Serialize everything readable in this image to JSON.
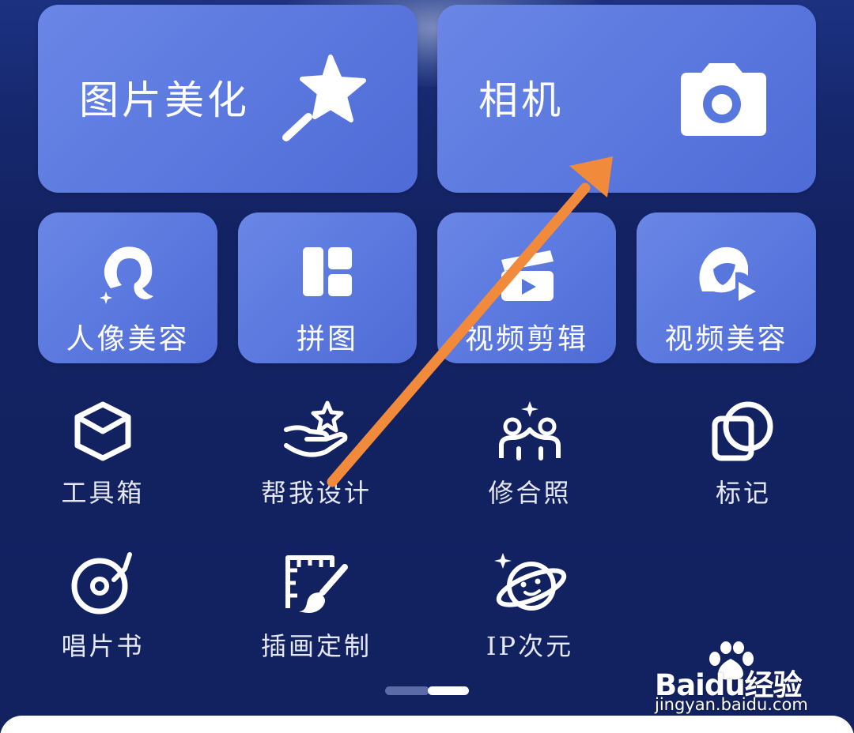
{
  "big_cards": [
    {
      "label": "图片美化",
      "icon": "magic-wand-icon"
    },
    {
      "label": "相机",
      "icon": "camera-icon"
    }
  ],
  "small_cards": [
    {
      "label": "人像美容",
      "icon": "portrait-hair-icon"
    },
    {
      "label": "拼图",
      "icon": "collage-layout-icon"
    },
    {
      "label": "视频剪辑",
      "icon": "clapperboard-icon"
    },
    {
      "label": "视频美容",
      "icon": "video-face-icon"
    }
  ],
  "tools": [
    {
      "label": "工具箱",
      "icon": "toolbox-cube-icon"
    },
    {
      "label": "帮我设计",
      "icon": "hand-star-icon"
    },
    {
      "label": "修合照",
      "icon": "group-photo-icon"
    },
    {
      "label": "标记",
      "icon": "overlap-squares-icon"
    },
    {
      "label": "唱片书",
      "icon": "record-player-icon"
    },
    {
      "label": "插画定制",
      "icon": "ruler-brush-icon"
    },
    {
      "label": "IP次元",
      "icon": "planet-icon"
    }
  ],
  "pager": {
    "pages": 2,
    "active": 2
  },
  "watermark": {
    "logo": "Baidu经验",
    "url": "jingyan.baidu.com"
  },
  "colors": {
    "background": "#132262",
    "card": "#5b79df",
    "annotation_arrow": "#f28a3c"
  }
}
